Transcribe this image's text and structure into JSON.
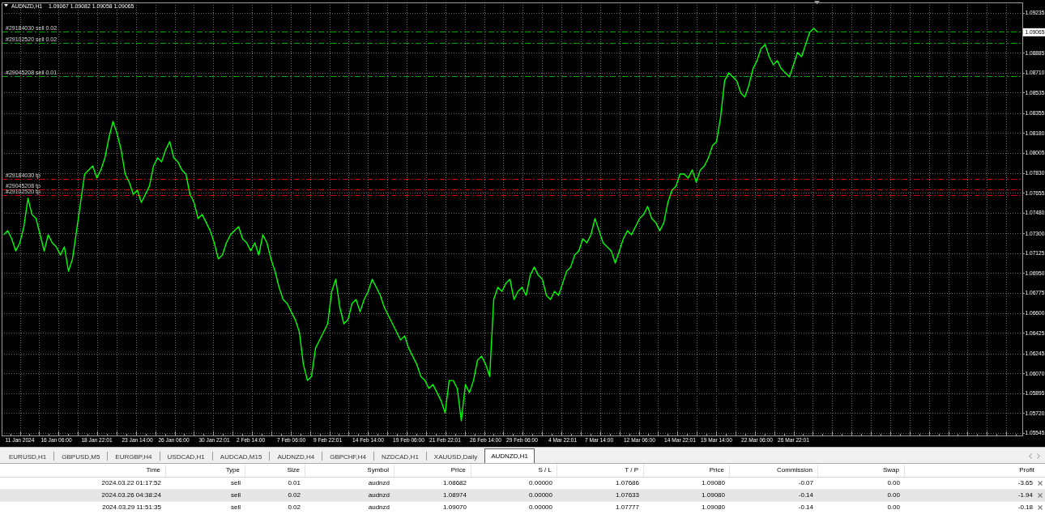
{
  "chart": {
    "symbol": "AUDNZD,H1",
    "ohlc": [
      "1.09067",
      "1.09082",
      "1.09058",
      "1.09065"
    ],
    "price_tag": {
      "label": "1.09065"
    },
    "chart_data": {
      "type": "line",
      "grid": true,
      "ylim": [
        1.05524,
        1.09327
      ],
      "categories": [
        null,
        null,
        null,
        null,
        "11 Jan 2024",
        null,
        null,
        null,
        null,
        null,
        null,
        null,
        null,
        "16 Jan 06:00",
        null,
        null,
        null,
        null,
        null,
        null,
        null,
        null,
        null,
        "18 Jan 22:01",
        null,
        null,
        null,
        null,
        null,
        null,
        null,
        null,
        null,
        "23 Jan 14:00",
        null,
        null,
        null,
        null,
        null,
        null,
        null,
        null,
        "26 Jan 06:00",
        null,
        null,
        null,
        null,
        null,
        null,
        null,
        null,
        null,
        "30 Jan 22:01",
        null,
        null,
        null,
        null,
        null,
        null,
        null,
        null,
        "2 Feb 14:00",
        null,
        null,
        null,
        null,
        null,
        null,
        null,
        null,
        null,
        "7 Feb 06:00",
        null,
        null,
        null,
        null,
        null,
        null,
        null,
        null,
        "9 Feb 22:01",
        null,
        null,
        null,
        null,
        null,
        null,
        null,
        null,
        null,
        "14 Feb 14:00",
        null,
        null,
        null,
        null,
        null,
        null,
        null,
        null,
        null,
        "19 Feb 06:00",
        null,
        null,
        null,
        null,
        null,
        null,
        null,
        null,
        "21 Feb 22:01",
        null,
        null,
        null,
        null,
        null,
        null,
        null,
        null,
        null,
        "26 Feb 14:00",
        null,
        null,
        null,
        null,
        null,
        null,
        null,
        null,
        "29 Feb 06:00",
        null,
        null,
        null,
        null,
        null,
        null,
        null,
        null,
        null,
        "4 Mar 22:01",
        null,
        null,
        null,
        null,
        null,
        null,
        null,
        null,
        "7 Mar 14:00",
        null,
        null,
        null,
        null,
        null,
        null,
        null,
        null,
        null,
        "12 Mar 06:00",
        null,
        null,
        null,
        null,
        null,
        null,
        null,
        null,
        null,
        "14 Mar 22:01",
        null,
        null,
        null,
        null,
        null,
        null,
        null,
        null,
        "19 Mar 14:00",
        null,
        null,
        null,
        null,
        null,
        null,
        null,
        null,
        null,
        "22 Mar 06:00",
        null,
        null,
        null,
        null,
        null,
        null,
        null,
        null,
        "26 Mar 22:01",
        null,
        null,
        null,
        null,
        null,
        null,
        null,
        null,
        null,
        null,
        null,
        null,
        null,
        null,
        null,
        null,
        null,
        null,
        null,
        null,
        null,
        null,
        null,
        null,
        null,
        null,
        null,
        null,
        null,
        null,
        null,
        null,
        null,
        null,
        null,
        null,
        null,
        null,
        null,
        null,
        null,
        null,
        null,
        null,
        null,
        null,
        null,
        null,
        null,
        null,
        null,
        null,
        null,
        null,
        null,
        null
      ],
      "series": [
        {
          "color": "#00ff00",
          "values": [
            1.07287,
            1.07322,
            1.07251,
            1.07145,
            1.07216,
            1.07358,
            1.07607,
            1.07465,
            1.07429,
            1.07287,
            1.07145,
            1.07287,
            1.07216,
            1.0718,
            1.07109,
            1.0718,
            1.06967,
            1.07074,
            1.07322,
            1.07571,
            1.0782,
            1.07856,
            1.07891,
            1.07785,
            1.07856,
            1.07962,
            1.0814,
            1.08282,
            1.08176,
            1.08033,
            1.0782,
            1.07749,
            1.07642,
            1.07678,
            1.07571,
            1.07642,
            1.07714,
            1.07891,
            1.07962,
            1.07927,
            1.08033,
            1.08105,
            1.07962,
            1.07927,
            1.07856,
            1.0782,
            1.07642,
            1.07571,
            1.07429,
            1.07465,
            1.07394,
            1.07322,
            1.07216,
            1.07074,
            1.07109,
            1.07216,
            1.07287,
            1.07322,
            1.07358,
            1.07251,
            1.07216,
            1.07145,
            1.07216,
            1.07109,
            1.07287,
            1.07216,
            1.07074,
            1.06967,
            1.06825,
            1.06718,
            1.06683,
            1.06611,
            1.0654,
            1.06434,
            1.06149,
            1.06007,
            1.06043,
            1.06291,
            1.06363,
            1.06434,
            1.06505,
            1.06789,
            1.06896,
            1.06647,
            1.06505,
            1.0654,
            1.06683,
            1.06718,
            1.06611,
            1.06718,
            1.06789,
            1.06896,
            1.06825,
            1.06754,
            1.06647,
            1.06576,
            1.06505,
            1.06434,
            1.06363,
            1.06398,
            1.06291,
            1.0622,
            1.06149,
            1.06043,
            1.06007,
            1.05936,
            1.05972,
            1.059,
            1.05829,
            1.05723,
            1.06007,
            1.06007,
            1.05936,
            1.05652,
            1.05972,
            1.059,
            1.06007,
            1.06185,
            1.0622,
            1.06149,
            1.06043,
            1.06718,
            1.06825,
            1.06789,
            1.0686,
            1.06896,
            1.06718,
            1.06789,
            1.06825,
            1.06754,
            1.06931,
            1.07003,
            1.06931,
            1.06896,
            1.06754,
            1.06718,
            1.06789,
            1.06754,
            1.0686,
            1.06967,
            1.07003,
            1.07109,
            1.07145,
            1.07251,
            1.07216,
            1.07287,
            1.07429,
            1.07322,
            1.07216,
            1.0718,
            1.07145,
            1.07038,
            1.07145,
            1.07251,
            1.07322,
            1.07287,
            1.07358,
            1.07429,
            1.07465,
            1.07536,
            1.07429,
            1.07394,
            1.07322,
            1.07394,
            1.07571,
            1.07678,
            1.07714,
            1.0782,
            1.0782,
            1.07785,
            1.07856,
            1.07749,
            1.07856,
            1.07891,
            1.07962,
            1.08069,
            1.08105,
            1.08318,
            1.08638,
            1.08709,
            1.08673,
            1.08638,
            1.08531,
            1.08496,
            1.08602,
            1.08744,
            1.08816,
            1.08922,
            1.08958,
            1.08851,
            1.0878,
            1.08816,
            1.08744,
            1.08709,
            1.08673,
            1.0878,
            1.08887,
            1.08851,
            1.08958,
            1.09064,
            1.091,
            1.09065,
            null,
            null,
            null,
            null,
            null,
            null,
            null,
            null,
            null,
            null,
            null,
            null,
            null,
            null,
            null,
            null,
            null,
            null,
            null,
            null,
            null,
            null,
            null,
            null,
            null,
            null,
            null,
            null,
            null,
            null,
            null,
            null,
            null,
            null,
            null,
            null,
            null,
            null,
            null,
            null,
            null,
            null,
            null,
            null,
            null,
            null,
            null,
            null,
            null,
            null
          ]
        }
      ],
      "yticks": [
        {
          "value": 1.09235,
          "label": "1.09235"
        },
        {
          "value": 1.08885,
          "label": "1.08885"
        },
        {
          "value": 1.0871,
          "label": "1.08710"
        },
        {
          "value": 1.08535,
          "label": "1.08535"
        },
        {
          "value": 1.08355,
          "label": "1.08355"
        },
        {
          "value": 1.0818,
          "label": "1.08180"
        },
        {
          "value": 1.08005,
          "label": "1.08005"
        },
        {
          "value": 1.0783,
          "label": "1.07830"
        },
        {
          "value": 1.07655,
          "label": "1.07655"
        },
        {
          "value": 1.0748,
          "label": "1.07480"
        },
        {
          "value": 1.073,
          "label": "1.07300"
        },
        {
          "value": 1.07125,
          "label": "1.07125"
        },
        {
          "value": 1.0695,
          "label": "1.06950"
        },
        {
          "value": 1.06775,
          "label": "1.06775"
        },
        {
          "value": 1.066,
          "label": "1.06600"
        },
        {
          "value": 1.06425,
          "label": "1.06425"
        },
        {
          "value": 1.06245,
          "label": "1.06245"
        },
        {
          "value": 1.0607,
          "label": "1.06070"
        },
        {
          "value": 1.05895,
          "label": "1.05895"
        },
        {
          "value": 1.0572,
          "label": "1.05720"
        },
        {
          "value": 1.05545,
          "label": "1.05545"
        }
      ],
      "ref_lines": [
        {
          "axis": "y",
          "value": 1.0907,
          "label": "#29184030 sell 0.02",
          "color": "#00a800"
        },
        {
          "axis": "y",
          "value": 1.08974,
          "label": "#29102520 sell 0.02",
          "color": "#00a800"
        },
        {
          "axis": "y",
          "value": 1.08682,
          "label": "#29045208 sell 0.01",
          "color": "#00a800"
        },
        {
          "axis": "y",
          "value": 1.07777,
          "label": "#29184030 tp",
          "color": "#d40000"
        },
        {
          "axis": "y",
          "value": 1.07686,
          "label": "#29045208 tp",
          "color": "#d40000"
        },
        {
          "axis": "y",
          "value": 1.07633,
          "label": "#29102520 tp",
          "color": "#d40000"
        }
      ]
    }
  },
  "tabs": [
    {
      "label": "EURUSD,H1",
      "selected": false
    },
    {
      "label": "GBPUSD,M5",
      "selected": false
    },
    {
      "label": "EURGBP,H4",
      "selected": false
    },
    {
      "label": "USDCAD,H1",
      "selected": false
    },
    {
      "label": "AUDCAD,M15",
      "selected": false
    },
    {
      "label": "AUDNZD,H4",
      "selected": false
    },
    {
      "label": "GBPCHF,H4",
      "selected": false
    },
    {
      "label": "NZDCAD,H1",
      "selected": false
    },
    {
      "label": "XAUUSD,Daily",
      "selected": false
    },
    {
      "label": "AUDNZD,H1",
      "selected": true
    }
  ],
  "table": {
    "columns": [
      "Time",
      "Type",
      "Size",
      "Symbol",
      "Price",
      "S / L",
      "T / P",
      "Price",
      "Commission",
      "Swap",
      "Profit"
    ],
    "rows": [
      {
        "selected": false,
        "cells": [
          "2024.03.22 01:17:52",
          "sell",
          "0.01",
          "audnzd",
          "1.08682",
          "0.00000",
          "1.07686",
          "1.09080",
          "-0.07",
          "0.00",
          "-3.65"
        ]
      },
      {
        "selected": true,
        "cells": [
          "2024.03.26 04:38:24",
          "sell",
          "0.02",
          "audnzd",
          "1.08974",
          "0.00000",
          "1.07633",
          "1.09080",
          "-0.14",
          "0.00",
          "-1.94"
        ]
      },
      {
        "selected": false,
        "cells": [
          "2024.03.29 11:51:35",
          "sell",
          "0.02",
          "audnzd",
          "1.09070",
          "0.00000",
          "1.07777",
          "1.09080",
          "-0.14",
          "0.00",
          "-0.18"
        ]
      }
    ]
  }
}
